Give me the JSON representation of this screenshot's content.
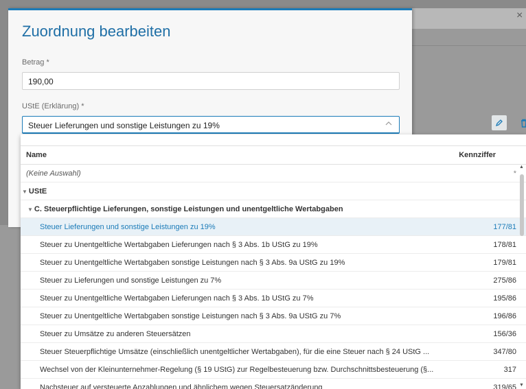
{
  "dialog": {
    "title": "Zuordnung bearbeiten",
    "amount_label": "Betrag *",
    "amount_value": "190,00",
    "ust_label": "UStE (Erklärung) *",
    "ust_value": "Steuer Lieferungen und sonstige Leistungen zu 19%"
  },
  "dropdown": {
    "col_name": "Name",
    "col_code": "Kennziffer",
    "none_label": "(Keine Auswahl)",
    "none_code": "*",
    "group1": "UStE",
    "group2": "C. Steuerpflichtige Lieferungen, sonstige Leistungen und unentgeltliche Wertabgaben",
    "items": [
      {
        "name": "Steuer Lieferungen und sonstige Leistungen zu 19%",
        "code": "177/81",
        "selected": true
      },
      {
        "name": "Steuer zu Unentgeltliche Wertabgaben Lieferungen nach § 3 Abs. 1b UStG zu 19%",
        "code": "178/81"
      },
      {
        "name": "Steuer zu Unentgeltliche Wertabgaben sonstige Leistungen nach § 3 Abs. 9a UStG zu 19%",
        "code": "179/81"
      },
      {
        "name": "Steuer zu Lieferungen und sonstige Leistungen zu 7%",
        "code": "275/86"
      },
      {
        "name": "Steuer zu Unentgeltliche Wertabgaben Lieferungen nach § 3 Abs. 1b UStG zu 7%",
        "code": "195/86"
      },
      {
        "name": "Steuer zu Unentgeltliche Wertabgaben sonstige Leistungen nach § 3 Abs. 9a UStG zu 7%",
        "code": "196/86"
      },
      {
        "name": "Steuer zu Umsätze zu anderen Steuersätzen",
        "code": "156/36"
      },
      {
        "name": "Steuer Steuerpflichtige Umsätze (einschließlich unentgeltlicher Wertabgaben), für die eine Steuer nach § 24 UStG ...",
        "code": "347/80"
      },
      {
        "name": "Wechsel von der Kleinunternehmer-Regelung (§ 19 UStG) zur Regelbesteuerung bzw. Durchschnittsbesteuerung (§...",
        "code": "317"
      },
      {
        "name": "Nachsteuer auf versteuerte Anzahlungen und ähnlichem wegen Steuersatzänderung",
        "code": "319/65"
      }
    ]
  },
  "background": {
    "close_glyph": "×"
  }
}
